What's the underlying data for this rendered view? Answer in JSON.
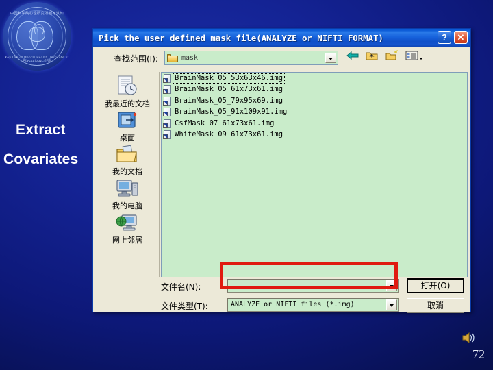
{
  "slide": {
    "headline_line1": "Extract",
    "headline_line2": "Covariates",
    "page_number": "72",
    "logo": {
      "text_top": "中国科学院心理研究所脑与认知",
      "text_bottom": "Key Lab of Mental Health, Institute of Psychology, CAS",
      "icon": "brain-heads-logo"
    },
    "speaker_icon": "speaker-icon",
    "background_color": "#0d1878"
  },
  "dialog": {
    "title": "Pick the user defined mask file(ANALYZE or NIFTI FORMAT)",
    "titlebar_buttons": [
      {
        "name": "help-button",
        "glyph": "?"
      },
      {
        "name": "close-button",
        "glyph": "✕"
      }
    ],
    "lookin": {
      "label": "查找范围(I):",
      "value": "mask",
      "icon": "folder-icon",
      "dropdown_icon": "chevron-down-icon"
    },
    "toolbar": [
      {
        "name": "back-button",
        "icon": "back-arrow-icon"
      },
      {
        "name": "up-one-level-button",
        "icon": "up-folder-icon"
      },
      {
        "name": "new-folder-button",
        "icon": "new-folder-icon"
      },
      {
        "name": "views-button",
        "icon": "views-list-icon"
      }
    ],
    "places": [
      {
        "label": "我最近的文档",
        "icon": "recent-documents-icon"
      },
      {
        "label": "桌面",
        "icon": "desktop-icon"
      },
      {
        "label": "我的文档",
        "icon": "my-documents-icon"
      },
      {
        "label": "我的电脑",
        "icon": "my-computer-icon"
      },
      {
        "label": "网上邻居",
        "icon": "network-places-icon"
      }
    ],
    "files": [
      {
        "name": "BrainMask_05_53x63x46.img",
        "icon": "img-file-icon",
        "focused": true
      },
      {
        "name": "BrainMask_05_61x73x61.img",
        "icon": "img-file-icon",
        "focused": false
      },
      {
        "name": "BrainMask_05_79x95x69.img",
        "icon": "img-file-icon",
        "focused": false
      },
      {
        "name": "BrainMask_05_91x109x91.img",
        "icon": "img-file-icon",
        "focused": false
      },
      {
        "name": "CsfMask_07_61x73x61.img",
        "icon": "img-file-icon",
        "focused": false
      },
      {
        "name": "WhiteMask_09_61x73x61.img",
        "icon": "img-file-icon",
        "focused": false
      }
    ],
    "filename_field": {
      "label": "文件名(N):",
      "value": "",
      "placeholder": "",
      "dropdown_icon": "chevron-down-icon"
    },
    "filetype_field": {
      "label": "文件类型(T):",
      "value": "ANALYZE or NIFTI files (*.img)",
      "dropdown_icon": "chevron-down-icon"
    },
    "open_button": "打开(O)",
    "cancel_button": "取消",
    "annotation_color": "#e01b10",
    "list_background": "#c9ecca"
  }
}
